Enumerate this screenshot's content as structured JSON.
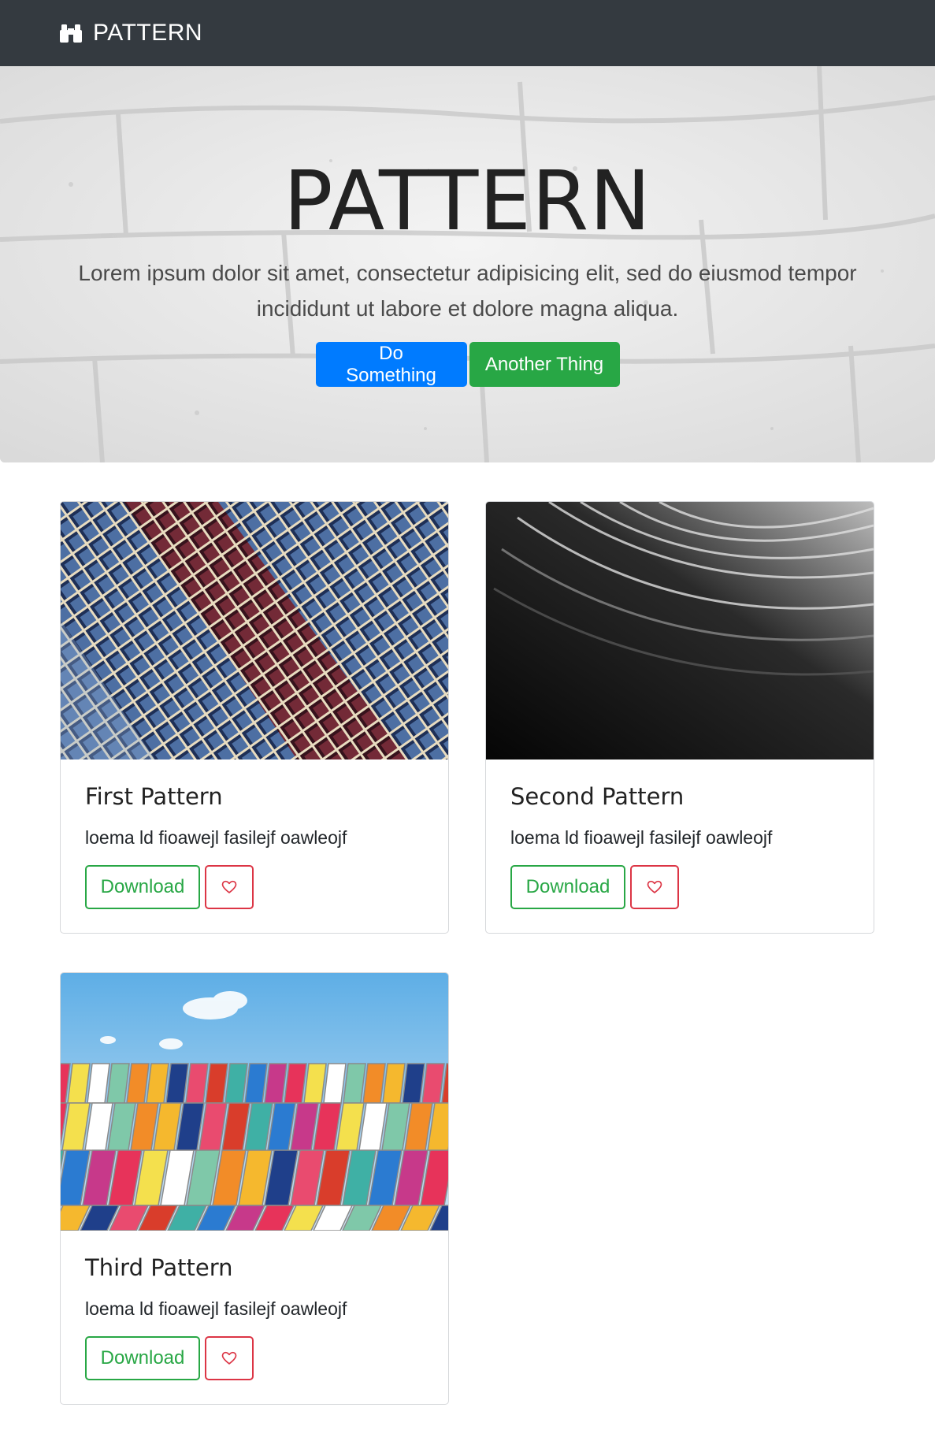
{
  "navbar": {
    "brand": "PATTERN",
    "brand_icon": "binoculars-icon"
  },
  "hero": {
    "title": "PATTERN",
    "lead": "Lorem ipsum dolor sit amet, consectetur adipisicing elit, sed do eiusmod tempor incididunt ut labore et dolore magna aliqua.",
    "primary_button": "Do Something",
    "secondary_button": "Another Thing"
  },
  "cards": [
    {
      "title": "First Pattern",
      "text": "loema ld fioawejl fasilejf oawleojf",
      "download_label": "Download",
      "like_icon": "heart-icon"
    },
    {
      "title": "Second Pattern",
      "text": "loema ld fioawejl fasilejf oawleojf",
      "download_label": "Download",
      "like_icon": "heart-icon"
    },
    {
      "title": "Third Pattern",
      "text": "loema ld fioawejl fasilejf oawleojf",
      "download_label": "Download",
      "like_icon": "heart-icon"
    }
  ],
  "colors": {
    "navbar_bg": "#343a40",
    "primary": "#007bff",
    "success": "#28a745",
    "danger": "#dc3545"
  }
}
